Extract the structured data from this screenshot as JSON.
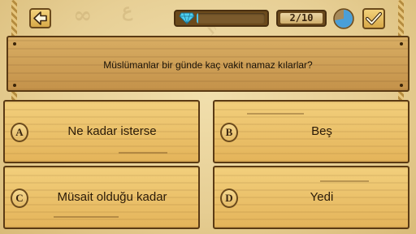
{
  "header": {
    "counter": "2/10",
    "progress_fraction": 0.02,
    "timer_fraction_remaining": 0.72
  },
  "question": {
    "text": "Müslümanlar bir günde kaç vakit namaz kılarlar?"
  },
  "answers": [
    {
      "letter": "A",
      "text": "Ne kadar isterse"
    },
    {
      "letter": "B",
      "text": "Beş"
    },
    {
      "letter": "C",
      "text": "Müsait olduğu kadar"
    },
    {
      "letter": "D",
      "text": "Yedi"
    }
  ],
  "colors": {
    "progress_fill": "#4fc3e8",
    "timer_fill": "#4a9fd8",
    "board": "#e4b45a",
    "border": "#5a3a14"
  },
  "icons": {
    "back": "arrow-left-icon",
    "gem": "diamond-icon",
    "timer": "pie-timer-icon",
    "confirm": "checkmark-icon"
  }
}
